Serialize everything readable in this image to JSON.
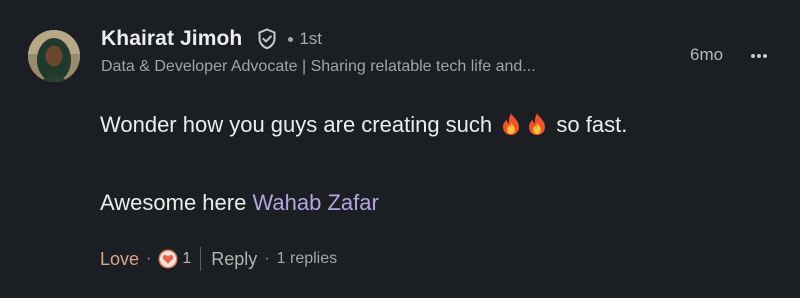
{
  "comment": {
    "author_name": "Khairat Jimoh",
    "degree": "1st",
    "headline": "Data & Developer Advocate | Sharing relatable tech life and...",
    "time": "6mo",
    "body_line1_before": "Wonder how you guys are creating such",
    "body_line1_after": "so fast.",
    "body_line2_prefix": "Awesome here",
    "mention": "Wahab Zafar",
    "reaction_label": "Love",
    "reaction_count": "1",
    "reply_label": "Reply",
    "replies_text": "1 replies"
  },
  "colors": {
    "background": "#1b1f23",
    "mention": "#b6a4e2",
    "love": "#d9a686"
  },
  "icons": {
    "verified": "shield-check-icon",
    "more": "ellipsis-horizontal-icon",
    "emoji": "fire-emoji",
    "reaction": "heart-reaction-icon"
  }
}
